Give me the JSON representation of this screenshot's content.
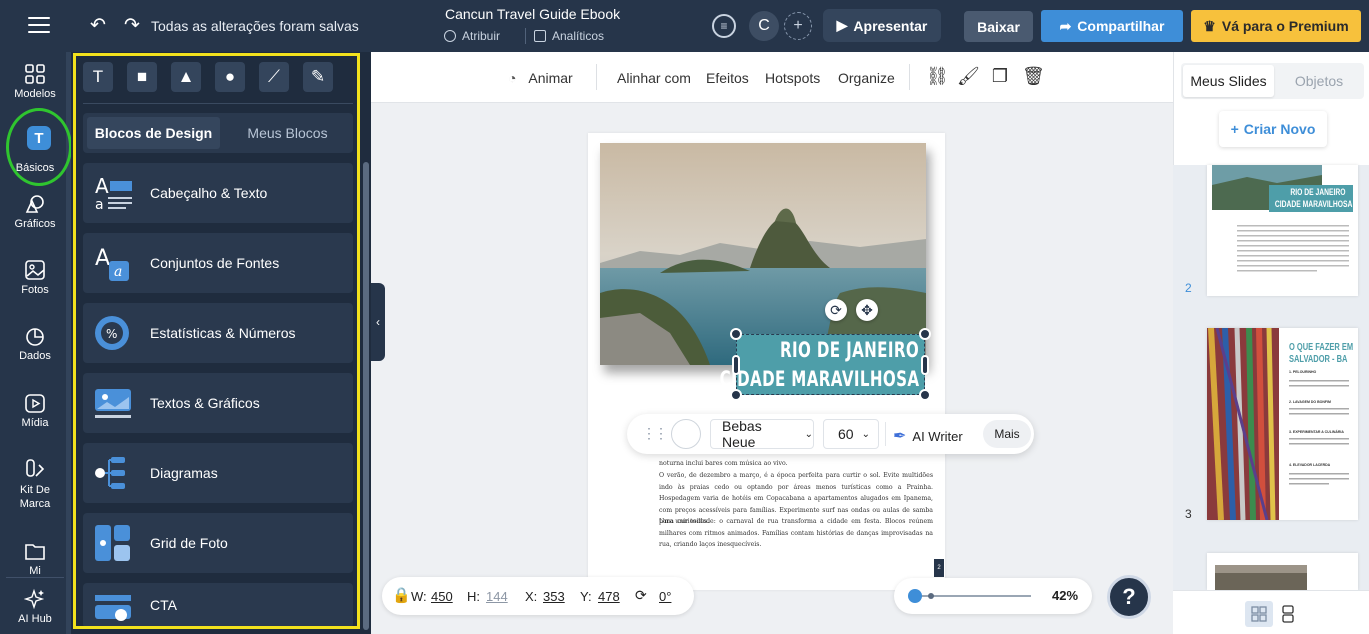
{
  "topbar": {
    "saved_status": "Todas as alterações foram salvas",
    "doc_title": "Cancun Travel Guide Ebook",
    "assign_label": "Atribuir",
    "analytics_label": "Analíticos",
    "avatar_initial": "C",
    "present_label": "Apresentar",
    "download_label": "Baixar",
    "share_label": "Compartilhar",
    "premium_label": "Vá para o Premium"
  },
  "rail": {
    "items": [
      {
        "label": "Modelos",
        "icon": "templates-icon"
      },
      {
        "label": "Básicos",
        "icon": "text-icon"
      },
      {
        "label": "Gráficos",
        "icon": "shapes-icon"
      },
      {
        "label": "Fotos",
        "icon": "photo-icon"
      },
      {
        "label": "Dados",
        "icon": "pie-chart-icon"
      },
      {
        "label": "Mídia",
        "icon": "media-icon"
      },
      {
        "label": "Kit De Marca",
        "icon": "brand-kit-icon"
      },
      {
        "label": "Mi",
        "icon": "folder-icon"
      },
      {
        "label": "AI Hub",
        "icon": "sparkles-icon"
      }
    ],
    "active_glyph": "T"
  },
  "panel": {
    "tools": [
      "T",
      "■",
      "▲",
      "●",
      "⟋",
      "✎"
    ],
    "tab_design_blocks": "Blocos de Design",
    "tab_my_blocks": "Meus Blocos",
    "blocks": [
      {
        "label": "Cabeçalho & Texto",
        "icon": "header-text-icon"
      },
      {
        "label": "Conjuntos de Fontes",
        "icon": "font-sets-icon"
      },
      {
        "label": "Estatísticas & Números",
        "icon": "stats-icon"
      },
      {
        "label": "Textos & Gráficos",
        "icon": "text-chart-icon"
      },
      {
        "label": "Diagramas",
        "icon": "diagram-icon"
      },
      {
        "label": "Grid de Foto",
        "icon": "photo-grid-icon"
      },
      {
        "label": "CTA",
        "icon": "cta-icon"
      }
    ]
  },
  "toolbar": {
    "animate": "Animar",
    "align": "Alinhar com",
    "effects": "Efeitos",
    "hotspots": "Hotspots",
    "organize": "Organize"
  },
  "slide": {
    "banner_line1": "RIO DE JANEIRO",
    "banner_line2": "CIDADE MARAVILHOSA",
    "paragraph1_tail": "noturna inclui bares com música ao vivo.",
    "paragraph2": "O verão, de dezembro a março, é a época perfeita para curtir o sol. Evite multidões indo às praias cedo ou optando por áreas menos turísticas como a Prainha. Hospedagem varia de hotéis em Copacabana a apartamentos alugados em Ipanema, com preços acessíveis para famílias. Experimente surf nas ondas ou aulas de samba para unir todos.",
    "paragraph3": "Uma curiosidade: o carnaval de rua transforma a cidade em festa. Blocos reúnem milhares com ritmos animados. Famílias contam histórias de danças improvisadas na rua, criando laços inesquecíveis.",
    "page_number": "2"
  },
  "format_bar": {
    "font": "Bebas Neue",
    "size": "60",
    "ai_writer": "AI Writer",
    "more": "Mais"
  },
  "dims": {
    "w_label": "W:",
    "w": "450",
    "h_label": "H:",
    "h": "144",
    "x_label": "X:",
    "x": "353",
    "y_label": "Y:",
    "y": "478",
    "rotation": "0°"
  },
  "zoom": {
    "level": "42%",
    "fraction": 0.0
  },
  "help_label": "?",
  "right_panel": {
    "tab_slides": "Meus Slides",
    "tab_objects": "Objetos",
    "new_label": "Criar Novo",
    "thumb2_title1": "RIO DE JANEIRO",
    "thumb2_title2": "CIDADE MARAVILHOSA",
    "thumb3_title1": "O QUE FAZER EM",
    "thumb3_title2": "SALVADOR - BA",
    "thumb3_h1": "1. PELOURINHO",
    "thumb3_h2": "2. LAVAGEM DO BONFIM",
    "thumb3_h3": "3. EXPERIMENTAR A CULINÁRIA",
    "thumb3_h4": "4. ELEVADOR LACERDA",
    "slide_numbers": [
      "2",
      "3"
    ]
  },
  "colors": {
    "dark_navy": "#26354a",
    "accent_blue": "#3e8ed8",
    "premium_yellow": "#f7c13c",
    "banner_teal": "#4e9ea9"
  }
}
